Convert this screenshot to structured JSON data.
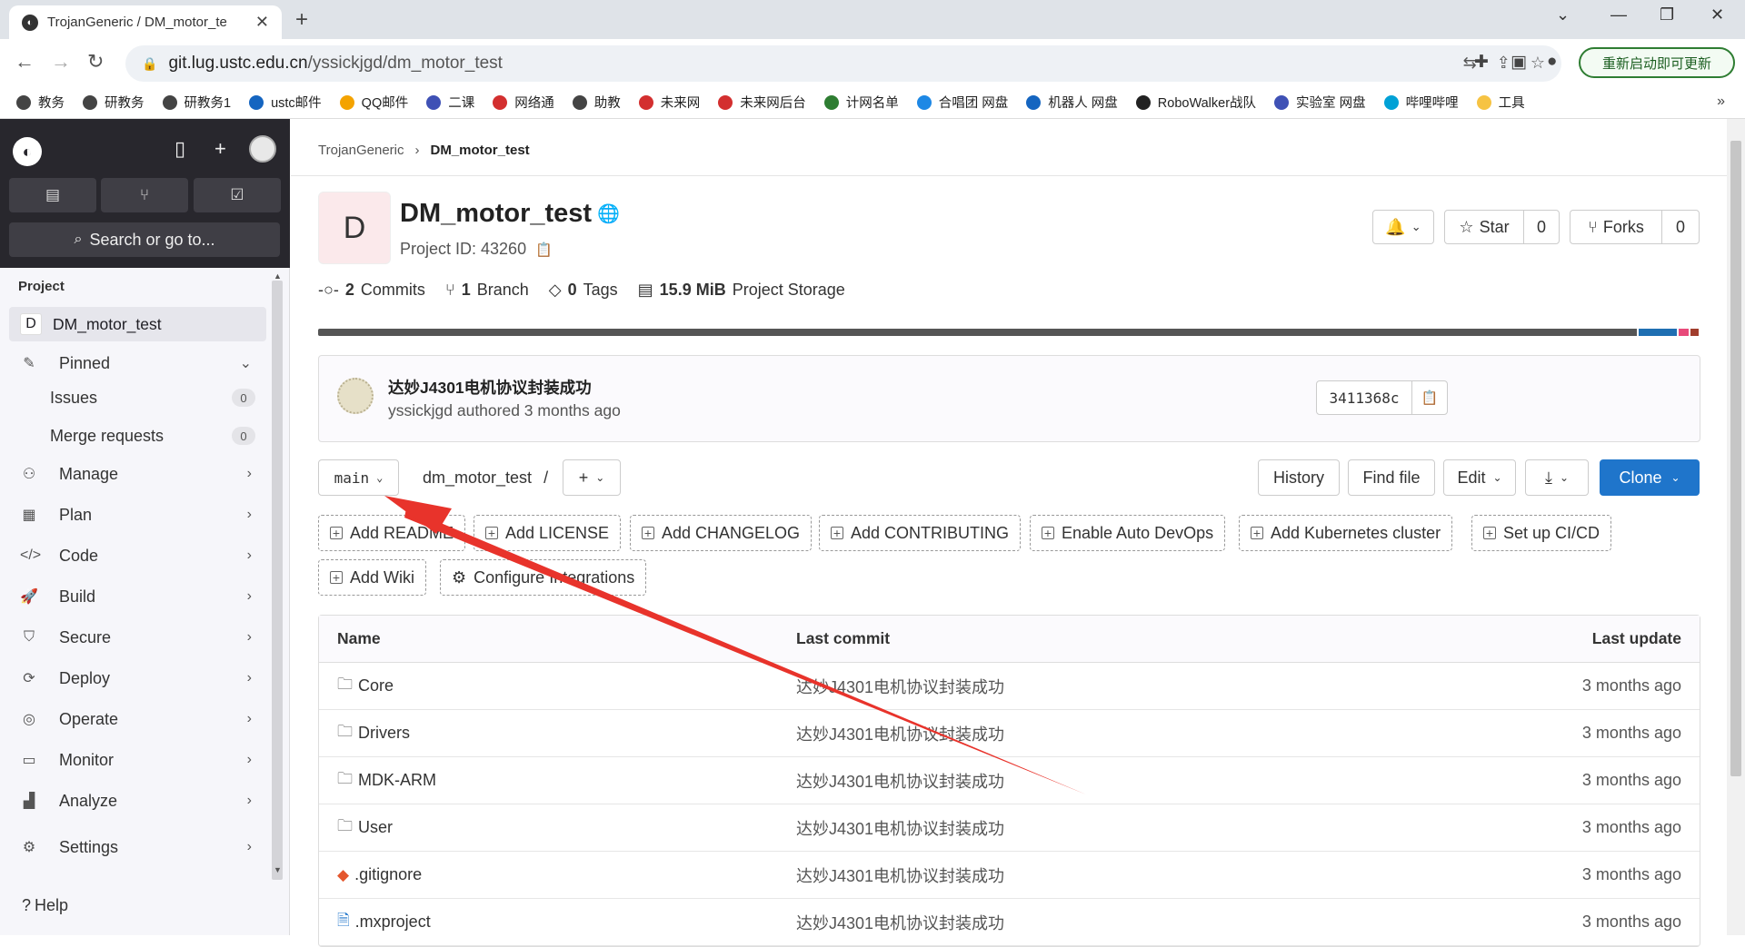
{
  "browser": {
    "tab_title": "TrojanGeneric / DM_motor_te",
    "url_host": "git.lug.ustc.edu.cn",
    "url_path": "/yssickjgd/dm_motor_test",
    "update_label": "重新启动即可更新",
    "bookmarks": [
      "教务",
      "研教务",
      "研教务1",
      "ustc邮件",
      "QQ邮件",
      "二课",
      "网络通",
      "助教",
      "未来网",
      "未来网后台",
      "计网名单",
      "合唱团 网盘",
      "机器人 网盘",
      "RoboWalker战队",
      "实验室 网盘",
      "哔哩哔哩",
      "工具"
    ]
  },
  "sidebar": {
    "search_label": "Search or go to...",
    "section": "Project",
    "project_initial": "D",
    "project_name": "DM_motor_test",
    "items": [
      {
        "label": "Pinned",
        "icon": "pin-icon"
      },
      {
        "label": "Issues",
        "count": "0"
      },
      {
        "label": "Merge requests",
        "count": "0"
      },
      {
        "label": "Manage",
        "icon": "users-icon"
      },
      {
        "label": "Plan",
        "icon": "calendar-icon"
      },
      {
        "label": "Code",
        "icon": "code-icon"
      },
      {
        "label": "Build",
        "icon": "rocket-icon"
      },
      {
        "label": "Secure",
        "icon": "shield-icon"
      },
      {
        "label": "Deploy",
        "icon": "deploy-icon"
      },
      {
        "label": "Operate",
        "icon": "operate-icon"
      },
      {
        "label": "Monitor",
        "icon": "monitor-icon"
      },
      {
        "label": "Analyze",
        "icon": "chart-icon"
      },
      {
        "label": "Settings",
        "icon": "gear-icon"
      }
    ],
    "help": "Help"
  },
  "breadcrumb": {
    "group": "TrojanGeneric",
    "project": "DM_motor_test"
  },
  "project": {
    "initial": "D",
    "title": "DM_motor_test",
    "id_text": "Project ID: 43260",
    "star_label": "Star",
    "star_count": "0",
    "forks_label": "Forks",
    "forks_count": "0"
  },
  "stats": {
    "commits_num": "2",
    "commits_label": "Commits",
    "branch_num": "1",
    "branch_label": "Branch",
    "tags_num": "0",
    "tags_label": "Tags",
    "storage_num": "15.9 MiB",
    "storage_label": "Project Storage"
  },
  "language_bar": [
    {
      "color": "#555555",
      "share": 95.5
    },
    {
      "color": "#1f6fb2",
      "share": 2.8
    },
    {
      "color": "#e84a7a",
      "share": 0.7
    },
    {
      "color": "#a13d2d",
      "share": 0.6
    }
  ],
  "last_commit": {
    "message": "达妙J4301电机协议封装成功",
    "meta": "yssickjgd authored 3 months ago",
    "sha": "3411368c"
  },
  "repo_nav": {
    "branch": "main",
    "path": "dm_motor_test",
    "path_sep": "/",
    "history": "History",
    "find_file": "Find file",
    "edit": "Edit",
    "clone": "Clone"
  },
  "quick_actions": [
    "Add README",
    "Add LICENSE",
    "Add CHANGELOG",
    "Add CONTRIBUTING",
    "Enable Auto DevOps",
    "Add Kubernetes cluster",
    "Set up CI/CD",
    "Add Wiki",
    "Configure Integrations"
  ],
  "table": {
    "headers": {
      "name": "Name",
      "commit": "Last commit",
      "update": "Last update"
    },
    "rows": [
      {
        "name": "Core",
        "type": "folder",
        "commit": "达妙J4301电机协议封装成功",
        "update": "3 months ago"
      },
      {
        "name": "Drivers",
        "type": "folder",
        "commit": "达妙J4301电机协议封装成功",
        "update": "3 months ago"
      },
      {
        "name": "MDK-ARM",
        "type": "folder",
        "commit": "达妙J4301电机协议封装成功",
        "update": "3 months ago"
      },
      {
        "name": "User",
        "type": "folder",
        "commit": "达妙J4301电机协议封装成功",
        "update": "3 months ago"
      },
      {
        "name": ".gitignore",
        "type": "git",
        "commit": "达妙J4301电机协议封装成功",
        "update": "3 months ago"
      },
      {
        "name": ".mxproject",
        "type": "file",
        "commit": "达妙J4301电机协议封装成功",
        "update": "3 months ago"
      }
    ]
  }
}
